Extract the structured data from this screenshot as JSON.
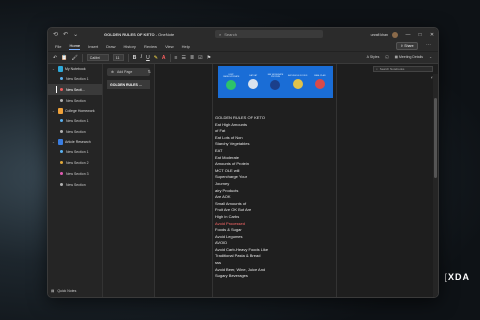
{
  "titlebar": {
    "doc_title": "GOLDEN RULES OF KETO",
    "app_name": "OneNote",
    "search_label": "Search",
    "user_name": "unrafi khan"
  },
  "menubar": {
    "items": [
      "File",
      "Home",
      "Insert",
      "Draw",
      "History",
      "Review",
      "View",
      "Help"
    ],
    "active": "Home",
    "share_label": "Share"
  },
  "ribbon": {
    "font": "Calibri",
    "size": "11",
    "styles_label": "Styles",
    "meeting_label": "Meeting Details"
  },
  "sidebar": {
    "notebooks": [
      {
        "name": "My Notebook",
        "color": "#2ea9d9",
        "sections": [
          {
            "name": "New Section 1",
            "color": "#5bb1f0"
          },
          {
            "name": "New Secti...",
            "color": "#f05b5b",
            "selected": true
          },
          {
            "name": "New Section",
            "color": "#b0b0b0"
          }
        ]
      },
      {
        "name": "College Homework",
        "color": "#f0a23a",
        "sections": [
          {
            "name": "New Section 1",
            "color": "#5bb1f0"
          },
          {
            "name": "New Section",
            "color": "#b0b0b0"
          }
        ]
      },
      {
        "name": "Article Research",
        "color": "#3a7de0",
        "sections": [
          {
            "name": "New Section 1",
            "color": "#5bb1f0"
          },
          {
            "name": "New Section 2",
            "color": "#e0a83a"
          },
          {
            "name": "New Section 3",
            "color": "#e05bb0"
          },
          {
            "name": "New Section",
            "color": "#b0b0b0"
          }
        ]
      }
    ],
    "quick_notes": "Quick Notes"
  },
  "pagelist": {
    "add_page": "Add Page",
    "pages": [
      "GOLDEN RULES ..."
    ]
  },
  "content": {
    "search_placeholder": "Search Notebooks",
    "banner": {
      "items": [
        {
          "text": "LIMIT CARBOHYDRATE",
          "color": "#2dc36a"
        },
        {
          "text": "EAT FAT",
          "color": "#d9e2ee"
        },
        {
          "text": "EAT MODERATE PROTEIN",
          "color": "#1b3f8a"
        },
        {
          "text": "EAT WHOLE FOODS",
          "color": "#e0c24a"
        },
        {
          "text": "MEAL PLAN",
          "color": "#d84a4a"
        }
      ]
    },
    "notes": [
      {
        "text": "GOLDEN RULES OF KETO",
        "warn": false
      },
      {
        "text": "Eat High Amounts",
        "warn": false
      },
      {
        "text": "of Fat",
        "warn": false
      },
      {
        "text": "Eat Lots of Non",
        "warn": false
      },
      {
        "text": "Starchy Vegetables",
        "warn": false
      },
      {
        "text": "EAT",
        "warn": false
      },
      {
        "text": "Eat Moderate",
        "warn": false
      },
      {
        "text": "Amounts of Protein",
        "warn": false
      },
      {
        "text": "MCT OLE will",
        "warn": false
      },
      {
        "text": "Supercharge Your",
        "warn": false
      },
      {
        "text": "Journey",
        "warn": false
      },
      {
        "text": "airy Products",
        "warn": false
      },
      {
        "text": "Are AOK",
        "warn": false
      },
      {
        "text": "Small Amounts of",
        "warn": false
      },
      {
        "text": "Fruit Are OK But Are",
        "warn": false
      },
      {
        "text": "High in Carbs",
        "warn": false
      },
      {
        "text": "Avoid Processed",
        "warn": true
      },
      {
        "text": "Foods & Sugar",
        "warn": false
      },
      {
        "text": "Avoid Legumes",
        "warn": false
      },
      {
        "text": "AVOID",
        "warn": false
      },
      {
        "text": "Avoid Carb-Heavy Foods Like",
        "warn": false
      },
      {
        "text": "Traditional Pasta & Bread",
        "warn": false
      },
      {
        "text": "sss",
        "warn": false
      },
      {
        "text": "Avoid Beer, Wine, Juice And",
        "warn": false
      },
      {
        "text": "Sugary Beverages",
        "warn": false
      }
    ]
  },
  "watermark": {
    "left": "XDA"
  }
}
